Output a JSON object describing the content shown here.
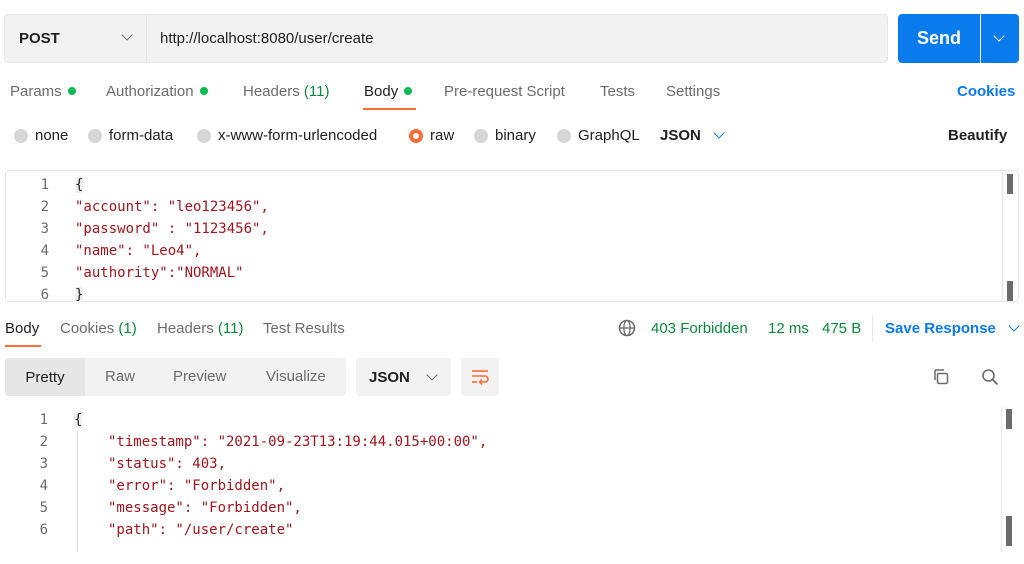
{
  "request": {
    "method": "POST",
    "url": "http://localhost:8080/user/create",
    "send_label": "Send"
  },
  "request_tabs": [
    {
      "label": "Params",
      "badge": "dot"
    },
    {
      "label": "Authorization",
      "badge": "dot"
    },
    {
      "label": "Headers",
      "count": "(11)"
    },
    {
      "label": "Body",
      "badge": "dot",
      "active": true
    },
    {
      "label": "Pre-request Script"
    },
    {
      "label": "Tests"
    },
    {
      "label": "Settings"
    }
  ],
  "cookies_label": "Cookies",
  "body_types": [
    {
      "label": "none"
    },
    {
      "label": "form-data"
    },
    {
      "label": "x-www-form-urlencoded"
    },
    {
      "label": "raw",
      "selected": true
    },
    {
      "label": "binary"
    },
    {
      "label": "GraphQL"
    }
  ],
  "raw_format": "JSON",
  "beautify_label": "Beautify",
  "request_body": {
    "line_numbers": [
      "1",
      "2",
      "3",
      "4",
      "5",
      "6"
    ],
    "lines": [
      "{",
      "\"account\": \"leo123456\",",
      "\"password\" : \"1123456\",",
      "\"name\": \"Leo4\",",
      "\"authority\":\"NORMAL\"",
      "}"
    ]
  },
  "response_tabs": [
    {
      "label": "Body",
      "active": true
    },
    {
      "label": "Cookies",
      "count": "(1)"
    },
    {
      "label": "Headers",
      "count": "(11)"
    },
    {
      "label": "Test Results"
    }
  ],
  "response_meta": {
    "status": "403 Forbidden",
    "time": "12 ms",
    "size": "475 B",
    "save_label": "Save Response"
  },
  "view_modes": [
    "Pretty",
    "Raw",
    "Preview",
    "Visualize"
  ],
  "response_format": "JSON",
  "response_body": {
    "line_numbers": [
      "1",
      "2",
      "3",
      "4",
      "5",
      "6"
    ],
    "lines": [
      "{",
      "\"timestamp\": \"2021-09-23T13:19:44.015+00:00\",",
      "\"status\": 403,",
      "\"error\": \"Forbidden\",",
      "\"message\": \"Forbidden\",",
      "\"path\": \"/user/create\""
    ]
  },
  "colors": {
    "accent_orange": "#ff6c37",
    "primary_blue": "#097bed",
    "success_green": "#0cbb52",
    "json_key": "#a3141e",
    "json_value": "#0c3b8e"
  },
  "icons": {
    "globe": "globe-icon",
    "copy": "copy-icon",
    "search": "search-icon",
    "wrap": "wrap-lines-icon"
  }
}
